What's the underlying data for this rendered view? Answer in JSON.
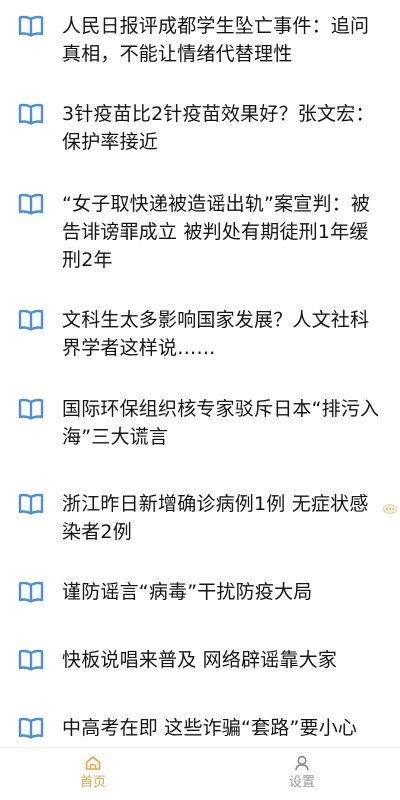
{
  "colors": {
    "accent": "#4a90d9",
    "text": "#151515",
    "nav_active": "#e8a33c",
    "nav_inactive": "#999999"
  },
  "news": {
    "items": [
      {
        "title": "人民日报评成都学生坠亡事件：追问真相，不能让情绪代替理性",
        "icon": "book-icon"
      },
      {
        "title": "3针疫苗比2针疫苗效果好？张文宏：保护率接近",
        "icon": "book-icon"
      },
      {
        "title": "“女子取快递被造谣出轨”案宣判：被告诽谤罪成立 被判处有期徒刑1年缓刑2年",
        "icon": "book-icon"
      },
      {
        "title": "文科生太多影响国家发展？人文社科界学者这样说……",
        "icon": "book-icon"
      },
      {
        "title": "国际环保组织核专家驳斥日本“排污入海”三大谎言",
        "icon": "book-icon"
      },
      {
        "title": "浙江昨日新增确诊病例1例 无症状感染者2例",
        "icon": "book-icon"
      },
      {
        "title": "谨防谣言“病毒”干扰防疫大局",
        "icon": "book-icon"
      },
      {
        "title": "快板说唱来普及 网络辟谣靠大家",
        "icon": "book-icon"
      },
      {
        "title": "中高考在即 这些诈骗“套路”要小心",
        "icon": "book-icon"
      }
    ]
  },
  "nav": {
    "home_label": "首页",
    "settings_label": "设置",
    "home_icon": "home-icon",
    "settings_icon": "person-icon"
  }
}
